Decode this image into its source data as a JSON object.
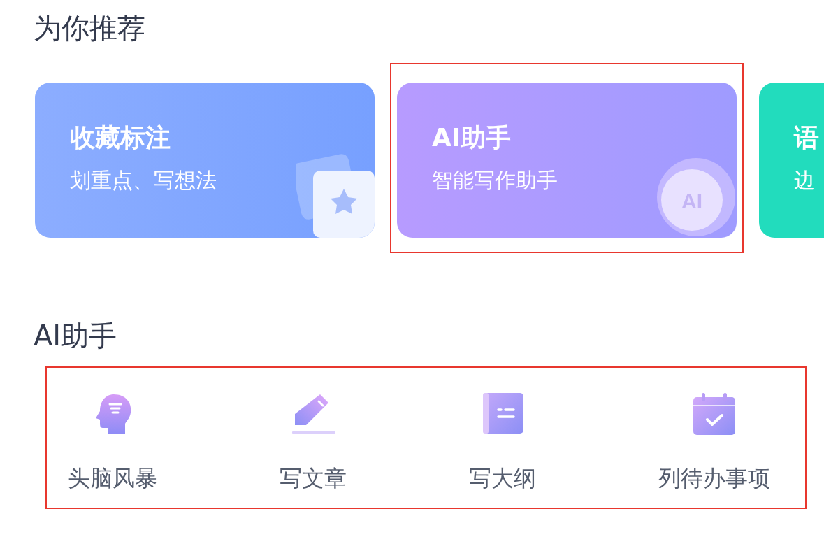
{
  "recommend": {
    "title": "为你推荐",
    "cards": [
      {
        "kind": "favorite",
        "title": "收藏标注",
        "subtitle": "划重点、写想法",
        "selected": false
      },
      {
        "kind": "ai",
        "title": "AI助手",
        "subtitle": "智能写作助手",
        "badge": "AI",
        "selected": true
      },
      {
        "kind": "voice",
        "title": "语",
        "subtitle": "边",
        "selected": false
      }
    ]
  },
  "assistant": {
    "title": "AI助手",
    "highlighted": true,
    "tools": [
      {
        "kind": "brain",
        "label": "头脑风暴"
      },
      {
        "kind": "pen",
        "label": "写文章"
      },
      {
        "kind": "outline",
        "label": "写大纲"
      },
      {
        "kind": "todo",
        "label": "列待办事项"
      }
    ]
  }
}
